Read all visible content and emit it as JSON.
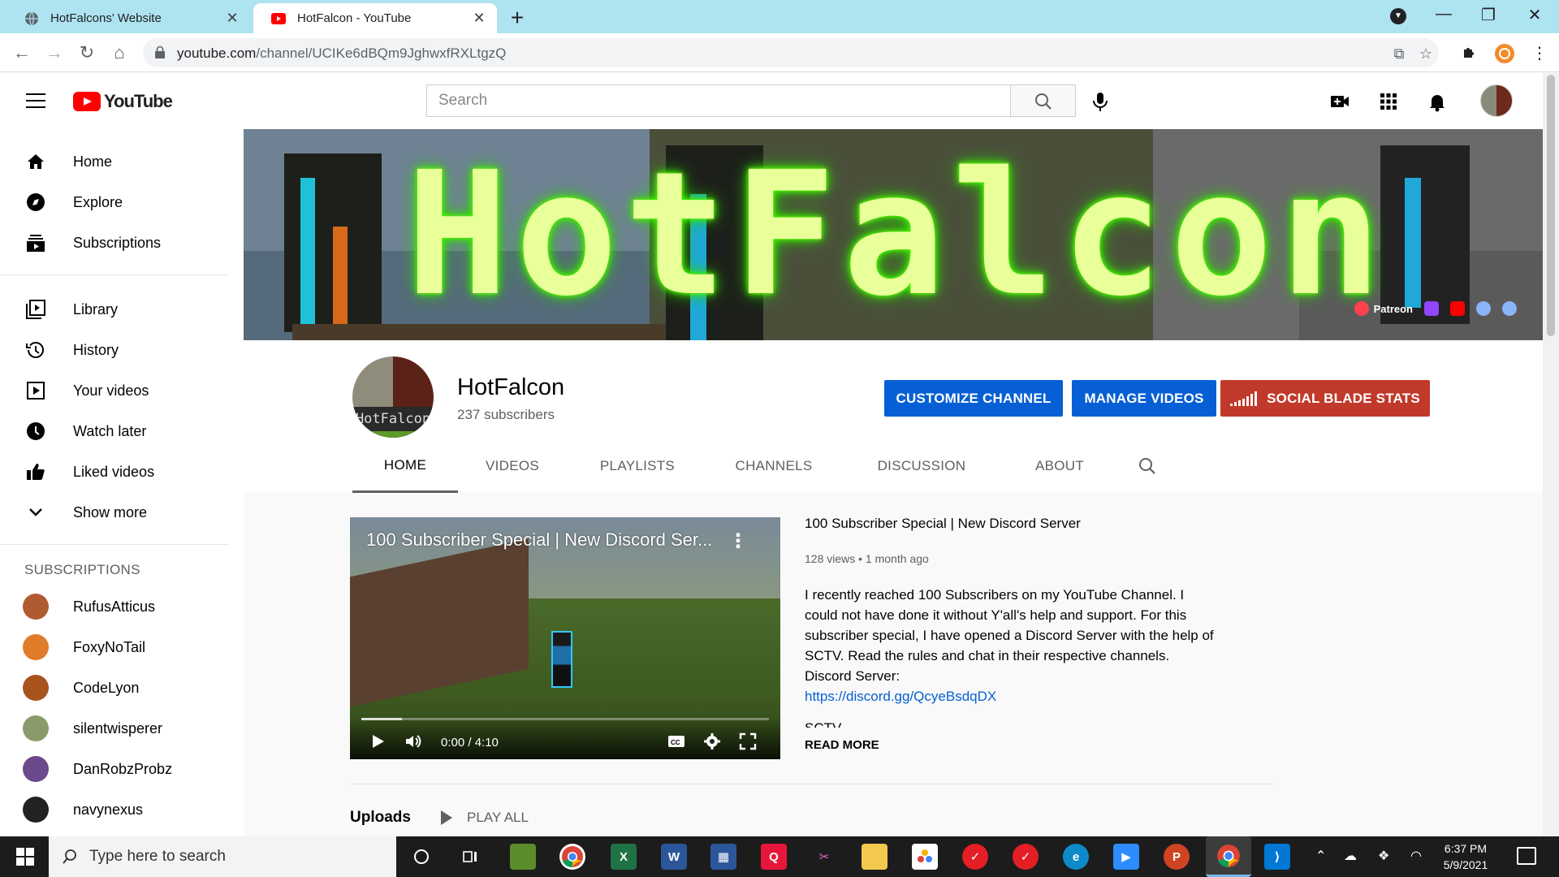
{
  "browser": {
    "tabs": [
      {
        "title": "HotFalcons' Website",
        "active": false
      },
      {
        "title": "HotFalcon - YouTube",
        "active": true
      }
    ],
    "url_host": "youtube.com",
    "url_path": "/channel/UCIKe6dBQm9JghwxfRXLtgzQ"
  },
  "masthead": {
    "logo_text": "YouTube",
    "search_placeholder": "Search"
  },
  "sidebar": {
    "primary": [
      {
        "label": "Home",
        "icon": "home-icon"
      },
      {
        "label": "Explore",
        "icon": "compass-icon"
      },
      {
        "label": "Subscriptions",
        "icon": "subscriptions-icon"
      }
    ],
    "library": [
      {
        "label": "Library",
        "icon": "library-icon"
      },
      {
        "label": "History",
        "icon": "history-icon"
      },
      {
        "label": "Your videos",
        "icon": "your-videos-icon"
      },
      {
        "label": "Watch later",
        "icon": "clock-icon"
      },
      {
        "label": "Liked videos",
        "icon": "thumbs-up-icon"
      },
      {
        "label": "Show more",
        "icon": "chevron-down-icon"
      }
    ],
    "subscriptions_heading": "SUBSCRIPTIONS",
    "subscriptions": [
      {
        "name": "RufusAtticus",
        "color": "#b05a32"
      },
      {
        "name": "FoxyNoTail",
        "color": "#e07b2a"
      },
      {
        "name": "CodeLyon",
        "color": "#a8521c"
      },
      {
        "name": "silentwisperer",
        "color": "#8a9a6a"
      },
      {
        "name": "DanRobzProbz",
        "color": "#6a4a8a"
      },
      {
        "name": "navynexus",
        "color": "#222222"
      }
    ]
  },
  "channel": {
    "banner_text": "HotFalcon",
    "banner_links": {
      "patreon": "Patreon"
    },
    "avatar_text": "HotFalcon",
    "name": "HotFalcon",
    "subscribers": "237 subscribers",
    "buttons": {
      "customize": "CUSTOMIZE CHANNEL",
      "manage": "MANAGE VIDEOS",
      "socialblade": "SOCIAL BLADE STATS"
    },
    "tabs": [
      "HOME",
      "VIDEOS",
      "PLAYLISTS",
      "CHANNELS",
      "DISCUSSION",
      "ABOUT"
    ],
    "selected_tab": "HOME"
  },
  "featured": {
    "player_title": "100 Subscriber Special | New Discord Ser...",
    "time": "0:00 / 4:10",
    "progress_fraction": 0.1,
    "title": "100 Subscriber Special | New Discord Server",
    "meta": "128 views • 1 month ago",
    "description": "I recently reached 100 Subscribers on my YouTube Channel. I could not have done it without Y'all's help and support. For this subscriber special, I have opened a Discord Server with the help of SCTV. Read the rules and chat in their respective channels.",
    "discord_label": "Discord Server:",
    "discord_link": "https://discord.gg/QcyeBsdqDX",
    "cut_line": "SCTV",
    "read_more": "READ MORE"
  },
  "uploads": {
    "heading": "Uploads",
    "play_all": "PLAY ALL"
  },
  "taskbar": {
    "search_placeholder": "Type here to search",
    "time": "6:37 PM",
    "date": "5/9/2021"
  }
}
